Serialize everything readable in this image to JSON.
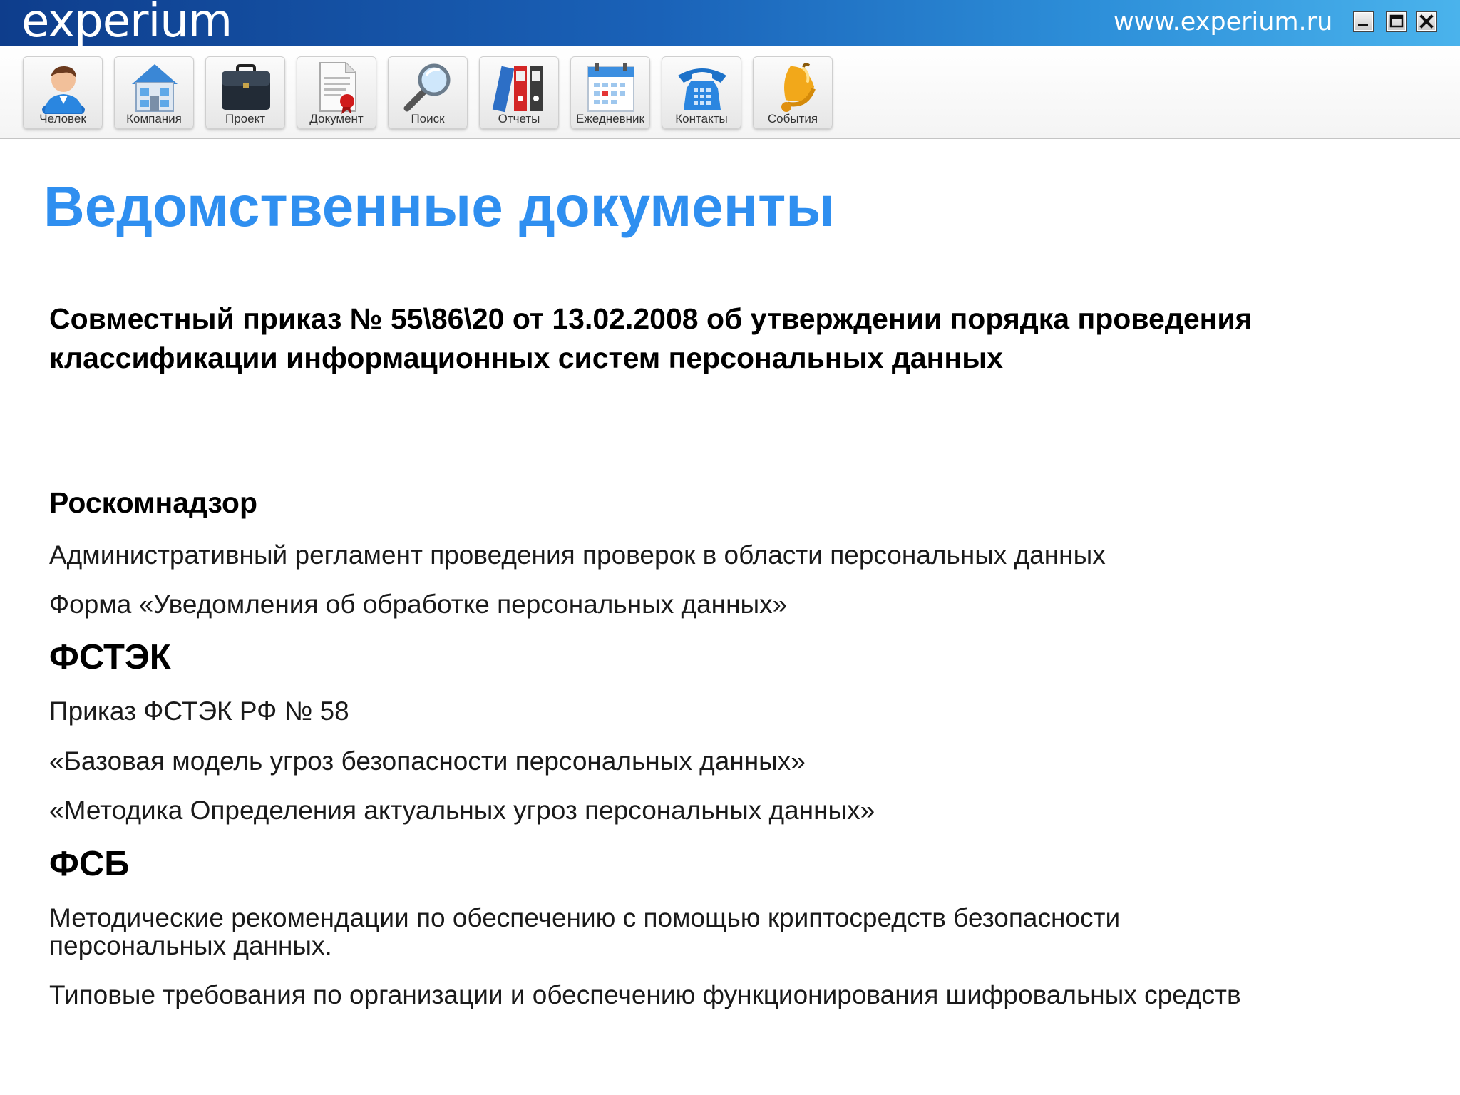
{
  "app": {
    "logo": "experium",
    "url": "www.experium.ru"
  },
  "window_controls": {
    "icons": [
      "minimize-icon",
      "maximize-icon",
      "close-icon"
    ]
  },
  "toolbar": {
    "items": [
      {
        "label": "Человек",
        "icon": "person-icon"
      },
      {
        "label": "Компания",
        "icon": "building-icon"
      },
      {
        "label": "Проект",
        "icon": "briefcase-icon"
      },
      {
        "label": "Документ",
        "icon": "document-icon"
      },
      {
        "label": "Поиск",
        "icon": "magnifier-icon"
      },
      {
        "label": "Отчеты",
        "icon": "binders-icon"
      },
      {
        "label": "Ежедневник",
        "icon": "calendar-icon"
      },
      {
        "label": "Контакты",
        "icon": "telephone-icon"
      },
      {
        "label": "События",
        "icon": "bell-icon"
      }
    ]
  },
  "content": {
    "title": "Ведомственные документы",
    "main_document": "Совместный приказ № 55\\86\\20 от 13.02.2008 об утверждении порядка проведения классификации информационных систем персональных данных",
    "sections": [
      {
        "title": "Роскомнадзор",
        "items": [
          "Административный регламент проведения проверок в области персональных данных",
          "Форма «Уведомления об обработке персональных данных»"
        ]
      },
      {
        "title": "ФСТЭК",
        "items": [
          "Приказ ФСТЭК РФ № 58",
          "«Базовая модель угроз безопасности персональных данных»",
          "«Методика Определения актуальных угроз персональных данных»"
        ]
      },
      {
        "title": "ФСБ",
        "items": [
          "Методические рекомендации по обеспечению с помощью криптосредств безопасности персональных данных.",
          "Типовые требования по организации и обеспечению функционирования шифровальных средств"
        ]
      }
    ]
  },
  "colors": {
    "title_blue": "#2f8ff0",
    "titlebar_start": "#0e3d8c",
    "titlebar_end": "#4ab3ec"
  }
}
